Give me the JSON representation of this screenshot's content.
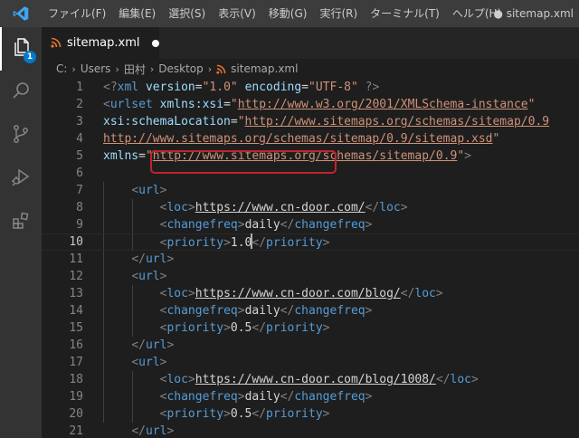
{
  "titlebar": {
    "menus": [
      "ファイル(F)",
      "編集(E)",
      "選択(S)",
      "表示(V)",
      "移動(G)",
      "実行(R)",
      "ターミナル(T)",
      "ヘルプ(H)"
    ],
    "window_title": "● sitemap.xml"
  },
  "activity_bar": {
    "items": [
      "files-icon",
      "search-icon",
      "source-control-icon",
      "run-debug-icon",
      "extensions-icon"
    ],
    "explorer_badge": "1",
    "accent": "#007acc"
  },
  "tab": {
    "label": "sitemap.xml",
    "rss_icon_color": "#e8742f"
  },
  "breadcrumb": {
    "parts": [
      "C:",
      "Users",
      "田村",
      "Desktop"
    ],
    "file": "sitemap.xml"
  },
  "editor": {
    "line_numbers": [
      "1",
      "2",
      "3",
      "4",
      "5",
      "6",
      "7",
      "8",
      "9",
      "10",
      "11",
      "12",
      "13",
      "14",
      "15",
      "16",
      "17",
      "18",
      "19",
      "20",
      "21"
    ],
    "current_line": "10",
    "lines": [
      [
        [
          "b",
          "<?"
        ],
        [
          "tag",
          "xml"
        ],
        [
          "txt",
          " "
        ],
        [
          "attr",
          "version"
        ],
        [
          "txt",
          "="
        ],
        [
          "str",
          "\"1.0\""
        ],
        [
          "txt",
          " "
        ],
        [
          "attr",
          "encoding"
        ],
        [
          "txt",
          "="
        ],
        [
          "str",
          "\"UTF-8\""
        ],
        [
          "txt",
          " "
        ],
        [
          "b",
          "?>"
        ]
      ],
      [
        [
          "b",
          "<"
        ],
        [
          "tag",
          "urlset"
        ],
        [
          "txt",
          " "
        ],
        [
          "attr",
          "xmlns:xsi"
        ],
        [
          "txt",
          "="
        ],
        [
          "str",
          "\""
        ],
        [
          "url",
          "http://www.w3.org/2001/XMLSchema-instance"
        ],
        [
          "str",
          "\""
        ]
      ],
      [
        [
          "attr",
          "xsi:schemaLocation"
        ],
        [
          "txt",
          "="
        ],
        [
          "str",
          "\""
        ],
        [
          "url",
          "http://www.sitemaps.org/schemas/sitemap/0.9"
        ]
      ],
      [
        [
          "url",
          "http://www.sitemaps.org/schemas/sitemap/0.9/sitemap.xsd"
        ],
        [
          "str",
          "\""
        ]
      ],
      [
        [
          "attr",
          "xmlns"
        ],
        [
          "txt",
          "="
        ],
        [
          "str",
          "\""
        ],
        [
          "url",
          "http://www.sitemaps.org/schemas/sitemap/0.9"
        ],
        [
          "str",
          "\""
        ],
        [
          "b",
          ">"
        ]
      ],
      [],
      [
        [
          "txt",
          "    "
        ],
        [
          "b",
          "<"
        ],
        [
          "tag",
          "url"
        ],
        [
          "b",
          ">"
        ]
      ],
      [
        [
          "txt",
          "        "
        ],
        [
          "b",
          "<"
        ],
        [
          "tag",
          "loc"
        ],
        [
          "b",
          ">"
        ],
        [
          "txtu",
          "https://www.cn-door.com/"
        ],
        [
          "b",
          "</"
        ],
        [
          "tag",
          "loc"
        ],
        [
          "b",
          ">"
        ]
      ],
      [
        [
          "txt",
          "        "
        ],
        [
          "b",
          "<"
        ],
        [
          "tag",
          "changefreq"
        ],
        [
          "b",
          ">"
        ],
        [
          "txt",
          "daily"
        ],
        [
          "b",
          "</"
        ],
        [
          "tag",
          "changefreq"
        ],
        [
          "b",
          ">"
        ]
      ],
      [
        [
          "txt",
          "        "
        ],
        [
          "b",
          "<"
        ],
        [
          "tag",
          "priority"
        ],
        [
          "b",
          ">"
        ],
        [
          "txt",
          "1.0"
        ],
        [
          "cursor",
          ""
        ],
        [
          "b",
          "</"
        ],
        [
          "tag",
          "priority"
        ],
        [
          "b",
          ">"
        ]
      ],
      [
        [
          "txt",
          "    "
        ],
        [
          "b",
          "</"
        ],
        [
          "tag",
          "url"
        ],
        [
          "b",
          ">"
        ]
      ],
      [
        [
          "txt",
          "    "
        ],
        [
          "b",
          "<"
        ],
        [
          "tag",
          "url"
        ],
        [
          "b",
          ">"
        ]
      ],
      [
        [
          "txt",
          "        "
        ],
        [
          "b",
          "<"
        ],
        [
          "tag",
          "loc"
        ],
        [
          "b",
          ">"
        ],
        [
          "txtu",
          "https://www.cn-door.com/blog/"
        ],
        [
          "b",
          "</"
        ],
        [
          "tag",
          "loc"
        ],
        [
          "b",
          ">"
        ]
      ],
      [
        [
          "txt",
          "        "
        ],
        [
          "b",
          "<"
        ],
        [
          "tag",
          "changefreq"
        ],
        [
          "b",
          ">"
        ],
        [
          "txt",
          "daily"
        ],
        [
          "b",
          "</"
        ],
        [
          "tag",
          "changefreq"
        ],
        [
          "b",
          ">"
        ]
      ],
      [
        [
          "txt",
          "        "
        ],
        [
          "b",
          "<"
        ],
        [
          "tag",
          "priority"
        ],
        [
          "b",
          ">"
        ],
        [
          "txt",
          "0.5"
        ],
        [
          "b",
          "</"
        ],
        [
          "tag",
          "priority"
        ],
        [
          "b",
          ">"
        ]
      ],
      [
        [
          "txt",
          "    "
        ],
        [
          "b",
          "</"
        ],
        [
          "tag",
          "url"
        ],
        [
          "b",
          ">"
        ]
      ],
      [
        [
          "txt",
          "    "
        ],
        [
          "b",
          "<"
        ],
        [
          "tag",
          "url"
        ],
        [
          "b",
          ">"
        ]
      ],
      [
        [
          "txt",
          "        "
        ],
        [
          "b",
          "<"
        ],
        [
          "tag",
          "loc"
        ],
        [
          "b",
          ">"
        ],
        [
          "txtu",
          "https://www.cn-door.com/blog/1008/"
        ],
        [
          "b",
          "</"
        ],
        [
          "tag",
          "loc"
        ],
        [
          "b",
          ">"
        ]
      ],
      [
        [
          "txt",
          "        "
        ],
        [
          "b",
          "<"
        ],
        [
          "tag",
          "changefreq"
        ],
        [
          "b",
          ">"
        ],
        [
          "txt",
          "daily"
        ],
        [
          "b",
          "</"
        ],
        [
          "tag",
          "changefreq"
        ],
        [
          "b",
          ">"
        ]
      ],
      [
        [
          "txt",
          "        "
        ],
        [
          "b",
          "<"
        ],
        [
          "tag",
          "priority"
        ],
        [
          "b",
          ">"
        ],
        [
          "txt",
          "0.5"
        ],
        [
          "b",
          "</"
        ],
        [
          "tag",
          "priority"
        ],
        [
          "b",
          ">"
        ]
      ],
      [
        [
          "txt",
          "    "
        ],
        [
          "b",
          "</"
        ],
        [
          "tag",
          "url"
        ],
        [
          "b",
          ">"
        ]
      ]
    ]
  }
}
